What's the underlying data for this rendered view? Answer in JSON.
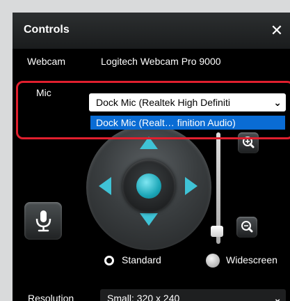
{
  "panel": {
    "title": "Controls",
    "close_glyph": "✕"
  },
  "webcam": {
    "label": "Webcam",
    "value": "Logitech Webcam Pro 9000"
  },
  "mic": {
    "label": "Mic",
    "selected": "Dock Mic (Realtek High Definiti",
    "highlighted_option": "Dock Mic (Realt… finition Audio)",
    "chevron": "⌄"
  },
  "format": {
    "standard_label": "Standard",
    "widescreen_label": "Widescreen",
    "selected": "Standard"
  },
  "resolution": {
    "label": "Resolution",
    "selected": "Small: 320 x 240",
    "chevron": "⌄"
  },
  "icons": {
    "close": "close-icon",
    "zoom_in": "zoom-in-icon",
    "zoom_out": "zoom-out-icon",
    "microphone": "microphone-icon",
    "pan_up": "arrow-up-icon",
    "pan_down": "arrow-down-icon",
    "pan_left": "arrow-left-icon",
    "pan_right": "arrow-right-icon"
  },
  "colors": {
    "highlight_outline": "#e01f2e",
    "dropdown_selection": "#0a6cd4",
    "joystick_accent": "#3fc3d6"
  }
}
